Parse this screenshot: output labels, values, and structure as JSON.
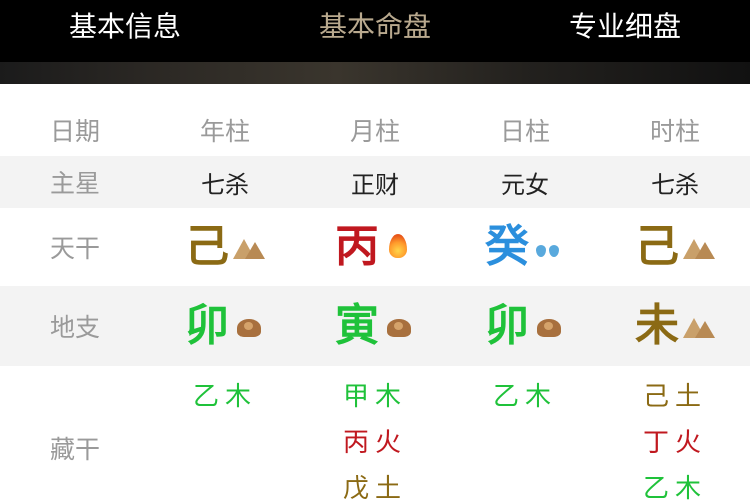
{
  "header": {
    "tabs": [
      {
        "label": "基本信息",
        "active": false
      },
      {
        "label": "基本命盘",
        "active": true
      },
      {
        "label": "专业细盘",
        "active": false
      }
    ]
  },
  "colors": {
    "earth": "#8b6a14",
    "fire": "#c0181f",
    "water": "#2b8fdd",
    "wood": "#1fc23a",
    "tab_active": "#b9a98e"
  },
  "table": {
    "header_row": {
      "label": "日期",
      "columns": [
        "年柱",
        "月柱",
        "日柱",
        "时柱"
      ]
    },
    "star_row": {
      "label": "主星",
      "values": [
        "七杀",
        "正财",
        "元女",
        "七杀"
      ]
    },
    "tiangan_row": {
      "label": "天干",
      "values": [
        {
          "char": "己",
          "element_icon": "mountain-icon"
        },
        {
          "char": "丙",
          "element_icon": "fire-icon"
        },
        {
          "char": "癸",
          "element_icon": "water-drops-icon"
        },
        {
          "char": "己",
          "element_icon": "mountain-icon"
        }
      ]
    },
    "dizhi_row": {
      "label": "地支",
      "values": [
        {
          "char": "卯",
          "element_icon": "dirt-pile-icon"
        },
        {
          "char": "寅",
          "element_icon": "dirt-pile-icon"
        },
        {
          "char": "卯",
          "element_icon": "dirt-pile-icon"
        },
        {
          "char": "未",
          "element_icon": "mountain-icon"
        }
      ]
    },
    "canggan_row": {
      "label": "藏干",
      "columns": [
        [
          "乙木"
        ],
        [
          "甲木",
          "丙火",
          "戊土"
        ],
        [
          "乙木"
        ],
        [
          "己土",
          "丁火",
          "乙木"
        ]
      ]
    }
  }
}
